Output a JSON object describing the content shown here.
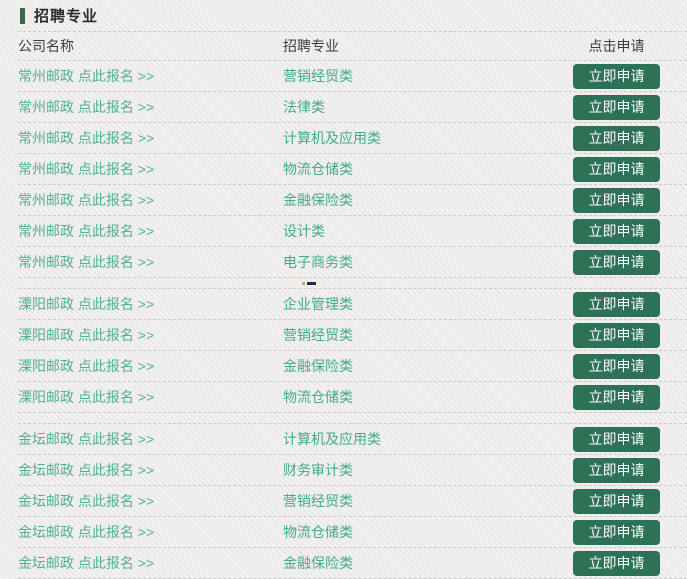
{
  "page": {
    "title": "招聘专业",
    "accent_color": "#2e6b50",
    "button_color": "#2d7156",
    "link_color": "#4fb094",
    "major_color": "#41ab87"
  },
  "table": {
    "headers": {
      "company": "公司名称",
      "major": "招聘专业",
      "apply": "点击申请"
    },
    "apply_label": "立即申请",
    "groups": [
      {
        "company": "常州邮政 点此报名 >>",
        "rows": [
          {
            "company": "常州邮政 点此报名 >>",
            "major": "营销经贸类"
          },
          {
            "company": "常州邮政 点此报名 >>",
            "major": "法律类"
          },
          {
            "company": "常州邮政 点此报名 >>",
            "major": "计算机及应用类"
          },
          {
            "company": "常州邮政 点此报名 >>",
            "major": "物流仓储类"
          },
          {
            "company": "常州邮政 点此报名 >>",
            "major": "金融保险类"
          },
          {
            "company": "常州邮政 点此报名 >>",
            "major": "设计类"
          },
          {
            "company": "常州邮政 点此报名 >>",
            "major": "电子商务类"
          }
        ]
      },
      {
        "company": "溧阳邮政 点此报名 >>",
        "rows": [
          {
            "company": "溧阳邮政 点此报名 >>",
            "major": "企业管理类"
          },
          {
            "company": "溧阳邮政 点此报名 >>",
            "major": "营销经贸类"
          },
          {
            "company": "溧阳邮政 点此报名 >>",
            "major": "金融保险类"
          },
          {
            "company": "溧阳邮政 点此报名 >>",
            "major": "物流仓储类"
          }
        ]
      },
      {
        "company": "金坛邮政 点此报名 >>",
        "rows": [
          {
            "company": "金坛邮政 点此报名 >>",
            "major": "计算机及应用类"
          },
          {
            "company": "金坛邮政 点此报名 >>",
            "major": "财务审计类"
          },
          {
            "company": "金坛邮政 点此报名 >>",
            "major": "营销经贸类"
          },
          {
            "company": "金坛邮政 点此报名 >>",
            "major": "物流仓储类"
          },
          {
            "company": "金坛邮政 点此报名 >>",
            "major": "金融保险类"
          }
        ]
      }
    ]
  }
}
